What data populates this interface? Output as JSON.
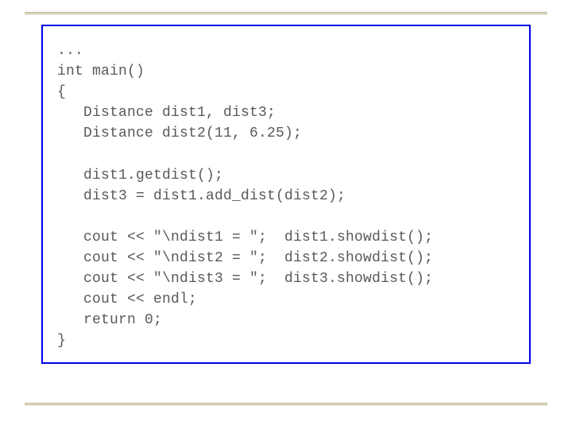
{
  "code": {
    "lines": [
      "...",
      "int main()",
      "{",
      "   Distance dist1, dist3;",
      "   Distance dist2(11, 6.25);",
      "",
      "   dist1.getdist();",
      "   dist3 = dist1.add_dist(dist2);",
      "",
      "   cout << \"\\ndist1 = \";  dist1.showdist();",
      "   cout << \"\\ndist2 = \";  dist2.showdist();",
      "   cout << \"\\ndist3 = \";  dist3.showdist();",
      "   cout << endl;",
      "   return 0;",
      "}"
    ]
  }
}
